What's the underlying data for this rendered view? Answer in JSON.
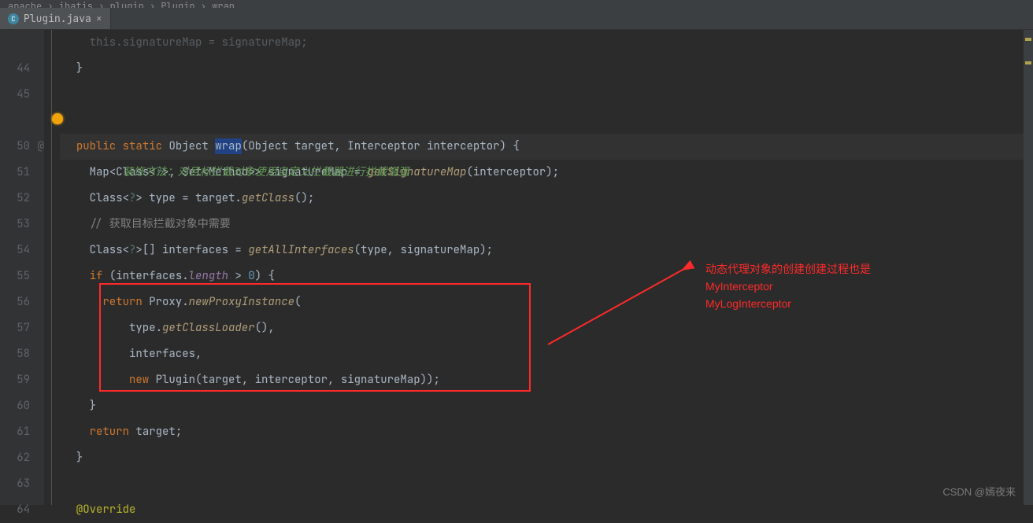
{
  "breadcrumb": {
    "path": "apache › ibatis › plugin › Plugin › wrap"
  },
  "tab": {
    "fileIcon": "C",
    "filename": "Plugin.java"
  },
  "docComment": "装饰方法：对目标拦截对象使用自定义拦截器进行拦截增强",
  "gutter": {
    "lines": [
      "",
      "44",
      "45",
      "",
      "50",
      "51",
      "52",
      "53",
      "54",
      "55",
      "56",
      "57",
      "58",
      "59",
      "60",
      "61",
      "62",
      "63",
      "64"
    ],
    "atSymbol": "@"
  },
  "code": {
    "l43_trail": "    this.signatureMap = signatureMap;",
    "l44": "  }",
    "l50": {
      "pre": "  ",
      "public": "public",
      "static": "static",
      "ret": "Object",
      "name": "wrap",
      "lp": "(",
      "p1t": "Object",
      "p1n": " target",
      "c": ", ",
      "p2t": "Interceptor",
      "p2n": " interceptor",
      "rp": ")",
      " br": " {"
    },
    "l51": {
      "indent": "    ",
      "Map": "Map",
      "lt": "<",
      "Class": "Class",
      "ltq": "<",
      "q": "?",
      "gtq": ">",
      "c1": ", ",
      "Set": "Set",
      "lt2": "<",
      "Method": "Method",
      "gt2": ">>",
      "sp": " signatureMap = ",
      "call": "getSignatureMap",
      "lp": "(",
      "arg": "interceptor",
      "rp": ")",
      ";": ";"
    },
    "l52": {
      "indent": "    ",
      "Class": "Class",
      "lt": "<",
      "q": "?",
      "gt": ">",
      "sp": " type = target.",
      "call": "getClass",
      "lp": "(",
      "rp": ")",
      ";": ";"
    },
    "l53": "    // 获取目标拦截对象中需要",
    "l54": {
      "indent": "    ",
      "Class": "Class",
      "lt": "<",
      "q": "?",
      "gt": ">",
      "arr": "[] interfaces = ",
      "call": "getAllInterfaces",
      "lp": "(",
      "args": "type, signatureMap",
      "rp": ")",
      ";": ";"
    },
    "l55": {
      "indent": "    ",
      "if": "if",
      " lp": " (",
      "var": "interfaces.",
      "len": "length",
      "op": " > ",
      "num": "0",
      "rp": ")",
      " br": " {"
    },
    "l56": {
      "indent": "      ",
      "return": "return",
      "sp": " Proxy.",
      "call": "newProxyInstance",
      "lp": "("
    },
    "l57": {
      "indent": "          ",
      "var": "type.",
      "call": "getClassLoader",
      "lp": "(",
      "rp": ")",
      ",": ","
    },
    "l58": {
      "indent": "          ",
      "var": "interfaces",
      ",": ","
    },
    "l59": {
      "indent": "          ",
      "new": "new",
      "sp": " ",
      "cls": "Plugin",
      "lp": "(",
      "args": "target, interceptor, signatureMap",
      "rp": "))",
      ";": ";"
    },
    "l60": "    }",
    "l61": {
      "indent": "    ",
      "return": "return",
      "sp": " target;"
    },
    "l62": "  }",
    "l64": "  @Override"
  },
  "annotation": {
    "line1": "动态代理对象的创建创建过程也是",
    "line2": "MyInterceptor",
    "line3": "MyLogInterceptor"
  },
  "watermark": "CSDN @嫣夜来"
}
